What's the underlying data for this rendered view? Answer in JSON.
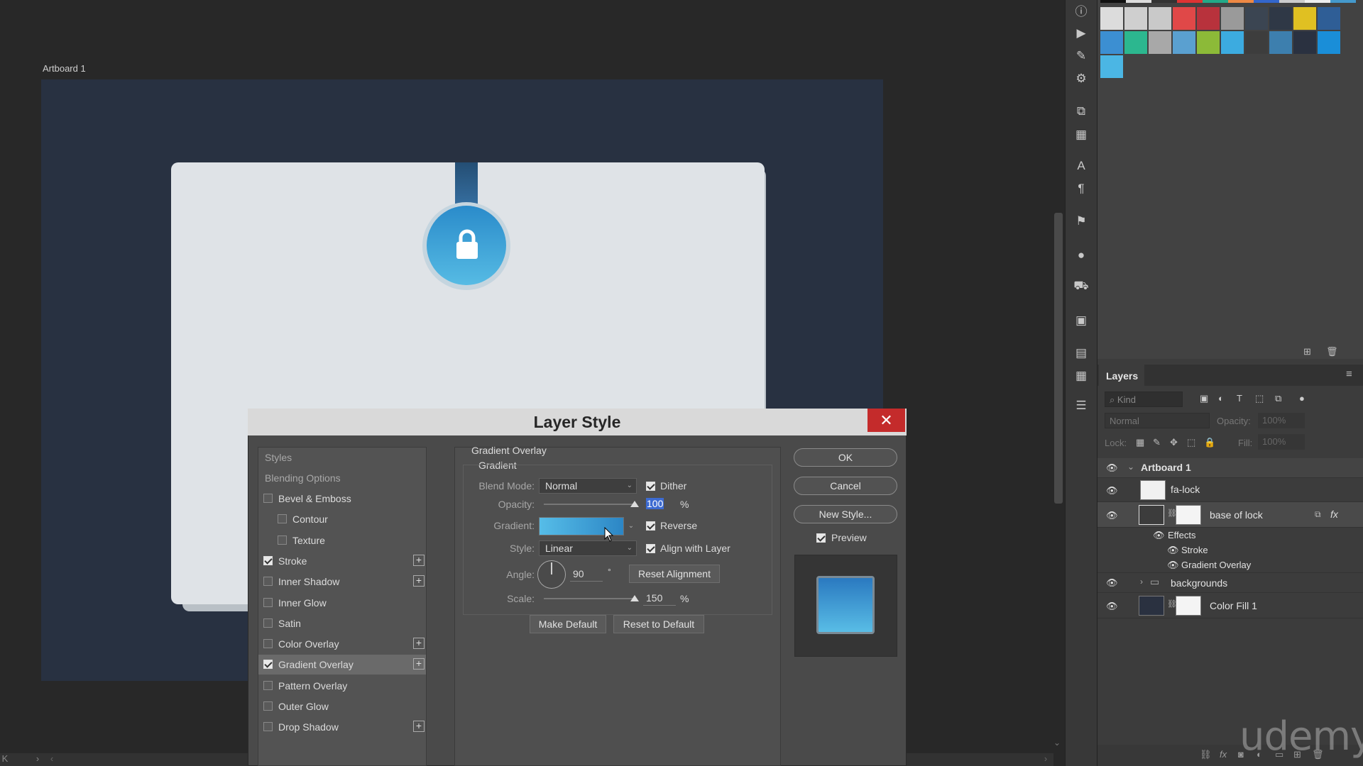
{
  "canvas": {
    "artboard_label": "Artboard 1",
    "scroll_left_arrow": "K",
    "scroll_right_arrow": "›",
    "scroll_left_arrow2": "‹",
    "scroll_right_arrow2": "›",
    "scroll_down_arrow": "⌄"
  },
  "swatches": {
    "colors": [
      "#dcdcdc",
      "#cfcfcf",
      "#c9c9c9",
      "#e04848",
      "#b8323c",
      "#9a9a9a",
      "#3b4552",
      "#2f3846",
      "#e0c022",
      "#2f5e96",
      "#3c8fd2",
      "#2cb78f",
      "#a8a8a8",
      "#5aa0d0",
      "#8cba38",
      "#3cabe0",
      "#3d3d3d",
      "#3d7fae",
      "#2a3140",
      "#1a8ed8",
      "#4bb6e4"
    ]
  },
  "tool_strip": {
    "icons": [
      "info-icon",
      "play-icon",
      "brush-preset-icon",
      "adjustment-sliders-icon",
      "clone-source-icon",
      "properties-icon",
      "character-icon",
      "paragraph-icon",
      "flag-icon",
      "drop-icon",
      "stamp-icon",
      "image-icon",
      "image-2-icon",
      "grid-icon",
      "layers-stack-icon"
    ],
    "glyphs": [
      "ⓘ",
      "▶",
      "✎",
      "⚙",
      "⧉",
      "▦",
      "A",
      "¶",
      "⚑",
      "●",
      "⛟",
      "▣",
      "▤",
      "▦",
      "☰"
    ]
  },
  "layers": {
    "tab_label": "Layers",
    "menu_glyph": "≡",
    "kind_placeholder": "Kind",
    "blend_mode": "Normal",
    "opacity_label": "Opacity:",
    "opacity_value": "100%",
    "lock_label": "Lock:",
    "fill_label": "Fill:",
    "fill_value": "100%",
    "rows": [
      {
        "name": "Artboard 1"
      },
      {
        "name": "fa-lock"
      },
      {
        "name": "base of lock"
      },
      {
        "name": "Effects"
      },
      {
        "name": "Stroke"
      },
      {
        "name": "Gradient Overlay"
      },
      {
        "name": "backgrounds"
      },
      {
        "name": "Color Fill 1"
      }
    ],
    "fx_label": "fx",
    "footer_fx": "fx"
  },
  "dialog": {
    "title": "Layer Style",
    "close_glyph": "✕",
    "styles_header": "Styles",
    "blending_options": "Blending Options",
    "items": [
      {
        "label": "Bevel & Emboss",
        "checked": false,
        "plus": false
      },
      {
        "label": "Contour",
        "checked": false,
        "plus": false
      },
      {
        "label": "Texture",
        "checked": false,
        "plus": false
      },
      {
        "label": "Stroke",
        "checked": true,
        "plus": true
      },
      {
        "label": "Inner Shadow",
        "checked": false,
        "plus": true
      },
      {
        "label": "Inner Glow",
        "checked": false,
        "plus": false
      },
      {
        "label": "Satin",
        "checked": false,
        "plus": false
      },
      {
        "label": "Color Overlay",
        "checked": false,
        "plus": true
      },
      {
        "label": "Gradient Overlay",
        "checked": true,
        "plus": true
      },
      {
        "label": "Pattern Overlay",
        "checked": false,
        "plus": false
      },
      {
        "label": "Outer Glow",
        "checked": false,
        "plus": false
      },
      {
        "label": "Drop Shadow",
        "checked": false,
        "plus": true
      }
    ],
    "plus_glyph": "+",
    "section_title": "Gradient Overlay",
    "group_title": "Gradient",
    "blend_mode_label": "Blend Mode:",
    "blend_mode_value": "Normal",
    "dither_label": "Dither",
    "opacity_label": "Opacity:",
    "opacity_value": "100",
    "opacity_level": 1.0,
    "percent": "%",
    "gradient_label": "Gradient:",
    "gradient_colors": [
      "#56bde8",
      "#2c86c5"
    ],
    "reverse_label": "Reverse",
    "style_label": "Style:",
    "style_value": "Linear",
    "align_label": "Align with Layer",
    "angle_label": "Angle:",
    "angle_value": "90",
    "degree": "°",
    "reset_alignment": "Reset Alignment",
    "scale_label": "Scale:",
    "scale_value": "150",
    "scale_level": 1.0,
    "make_default": "Make Default",
    "reset_default": "Reset to Default",
    "ok": "OK",
    "cancel": "Cancel",
    "new_style": "New Style...",
    "preview_label": "Preview"
  },
  "watermark": "udemy"
}
